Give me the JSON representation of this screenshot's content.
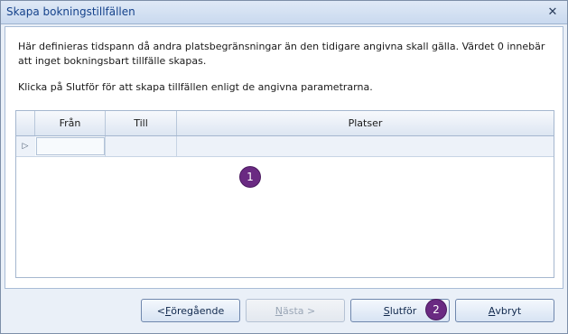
{
  "window": {
    "title": "Skapa bokningstillfällen"
  },
  "description": {
    "para1": "Här definieras tidspann då andra platsbegränsningar än den tidigare angivna skall gälla. Värdet 0 innebär att inget bokningsbart tillfälle skapas.",
    "para2": "Klicka på Slutför för att skapa tillfällen enligt de angivna parametrarna."
  },
  "grid": {
    "columns": [
      "Från",
      "Till",
      "Platser"
    ],
    "rows": [
      {
        "from": "",
        "to": "",
        "seats": ""
      }
    ],
    "row_indicator": "▷"
  },
  "badges": {
    "grid_badge": "1",
    "finish_badge": "2",
    "color": "#6a2a82"
  },
  "buttons": {
    "prev": {
      "prefix": "< ",
      "accel": "F",
      "rest": "öregående"
    },
    "next": {
      "accel": "N",
      "rest": "ästa >",
      "disabled": true
    },
    "finish": {
      "accel": "S",
      "rest": "lutför"
    },
    "cancel": {
      "accel": "A",
      "rest": "vbryt"
    }
  },
  "icons": {
    "close": "close-icon",
    "row_indicator": "row-indicator-icon"
  }
}
